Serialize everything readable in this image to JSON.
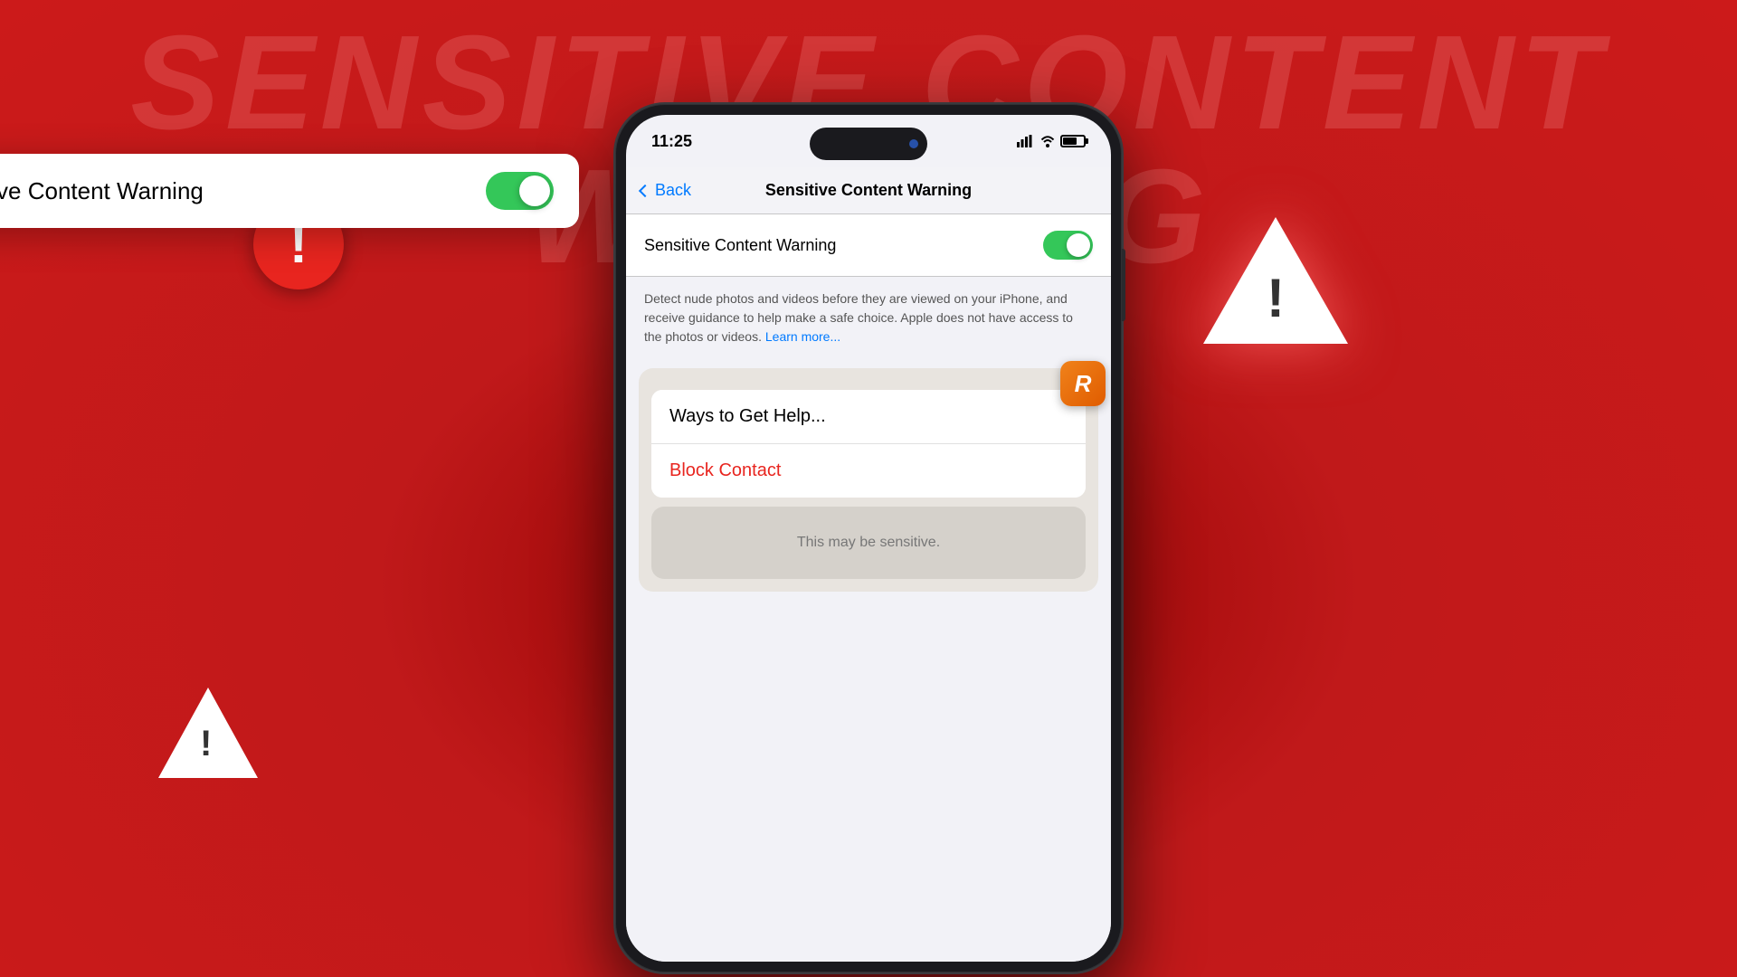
{
  "background": {
    "color": "#c0191a"
  },
  "main_title": {
    "text": "SENSITIVE CONTENT WARNING"
  },
  "overlay_card": {
    "label": "Sensitive Content Warning",
    "toggle_state": "on"
  },
  "phone": {
    "status_bar": {
      "time": "11:25",
      "signal": "||||",
      "battery": "58"
    },
    "nav_bar": {
      "back_label": "Back",
      "title": "Sensitive Content Warning"
    },
    "toggle_row": {
      "label": "Sensitive Content Warning"
    },
    "description": {
      "text": "Detect nude photos and videos before they are viewed on your iPhone, and receive guidance to help make a safe choice. Apple does not have access to the photos or videos.",
      "link_text": "Learn more..."
    },
    "action_buttons": {
      "ways_to_help": "Ways to Get Help...",
      "block_contact": "Block Contact"
    },
    "bottom_card": {
      "text": "This may be sensitive."
    }
  },
  "icons": {
    "warning_exclamation": "!",
    "back_chevron": "‹",
    "app_icon_letter": "R"
  }
}
